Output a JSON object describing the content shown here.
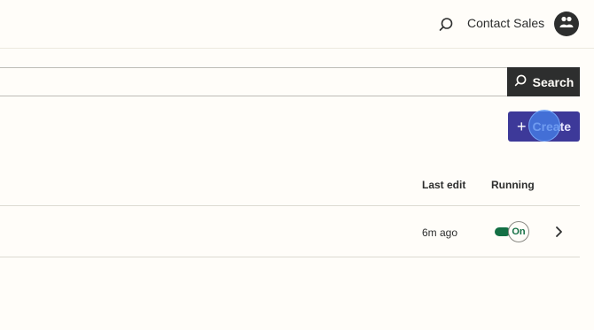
{
  "header": {
    "search_icon": "search-icon",
    "contact_sales_label": "Contact Sales",
    "avatar_icon": "users-icon"
  },
  "search": {
    "placeholder": "",
    "value": "",
    "button_label": "Search",
    "button_icon": "search-icon"
  },
  "actions": {
    "create_label": "Create",
    "create_icon": "plus-icon"
  },
  "table": {
    "columns": [
      "Last edit",
      "Running"
    ],
    "rows": [
      {
        "last_edit": "6m ago",
        "running": "On",
        "running_state": true
      }
    ]
  },
  "colors": {
    "background": "#fffdf9",
    "dark": "#2d2e2e",
    "primary_button": "#3d3999",
    "toggle_on": "#136f44"
  }
}
